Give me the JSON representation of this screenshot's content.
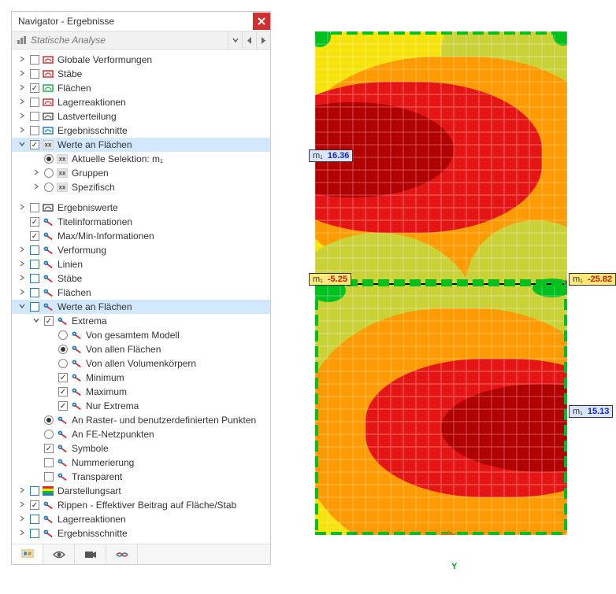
{
  "header": {
    "title": "Navigator - Ergebnisse"
  },
  "dropdown": {
    "label": "Statische Analyse"
  },
  "tree": [
    {
      "lvl": 0,
      "exp": ">",
      "ck": "box",
      "checked": false,
      "iconColor": "#d03030",
      "label": "Globale Verformungen"
    },
    {
      "lvl": 0,
      "exp": ">",
      "ck": "box",
      "checked": false,
      "iconColor": "#d03030",
      "label": "Stäbe"
    },
    {
      "lvl": 0,
      "exp": ">",
      "ck": "box",
      "checked": true,
      "iconColor": "#2aa84a",
      "label": "Flächen"
    },
    {
      "lvl": 0,
      "exp": ">",
      "ck": "box",
      "checked": false,
      "iconColor": "#d03030",
      "label": "Lagerreaktionen"
    },
    {
      "lvl": 0,
      "exp": ">",
      "ck": "box",
      "checked": false,
      "iconColor": "#555",
      "label": "Lastverteilung"
    },
    {
      "lvl": 0,
      "exp": ">",
      "ck": "box",
      "checked": false,
      "iconColor": "#2a7ab8",
      "label": "Ergebnisschnitte"
    },
    {
      "lvl": 0,
      "exp": "v",
      "ck": "box",
      "checked": true,
      "iconColor": "#888",
      "label": "Werte an Flächen",
      "sel": true,
      "xx": true
    },
    {
      "lvl": 1,
      "exp": " ",
      "ck": "radio",
      "checked": true,
      "iconColor": "#888",
      "label": "Aktuelle Selektion: m₁",
      "xx": true
    },
    {
      "lvl": 1,
      "exp": ">",
      "ck": "radio",
      "checked": false,
      "iconColor": "#888",
      "label": "Gruppen",
      "xx": true
    },
    {
      "lvl": 1,
      "exp": ">",
      "ck": "radio",
      "checked": false,
      "iconColor": "#888",
      "label": "Spezifisch",
      "xx": true
    },
    {
      "lvl": 0,
      "exp": ">",
      "ck": "box",
      "checked": false,
      "iconColor": "#555",
      "label": "Ergebniswerte",
      "divider": true
    },
    {
      "lvl": 0,
      "exp": " ",
      "ck": "box",
      "checked": true,
      "iconColor": "#2a7ab8",
      "label": "Titelinformationen",
      "pin": true
    },
    {
      "lvl": 0,
      "exp": " ",
      "ck": "box",
      "checked": true,
      "iconColor": "#2a7ab8",
      "label": "Max/Min-Informationen",
      "pin": true
    },
    {
      "lvl": 0,
      "exp": ">",
      "ck": "boxb",
      "checked": false,
      "iconColor": "#2a7ab8",
      "label": "Verformung",
      "pin": true
    },
    {
      "lvl": 0,
      "exp": ">",
      "ck": "boxb",
      "checked": false,
      "iconColor": "#2a7ab8",
      "label": "Linien",
      "pin": true
    },
    {
      "lvl": 0,
      "exp": ">",
      "ck": "boxb",
      "checked": false,
      "iconColor": "#2a7ab8",
      "label": "Stäbe",
      "pin": true
    },
    {
      "lvl": 0,
      "exp": ">",
      "ck": "boxb",
      "checked": false,
      "iconColor": "#2a7ab8",
      "label": "Flächen",
      "pin": true
    },
    {
      "lvl": 0,
      "exp": "v",
      "ck": "boxb",
      "checked": false,
      "iconColor": "#2a7ab8",
      "label": "Werte an Flächen",
      "sel": true,
      "pin": true
    },
    {
      "lvl": 1,
      "exp": "v",
      "ck": "box",
      "checked": true,
      "iconColor": "#2a7ab8",
      "label": "Extrema",
      "pin": true
    },
    {
      "lvl": 2,
      "exp": " ",
      "ck": "radio",
      "checked": false,
      "iconColor": "#2a7ab8",
      "label": "Von gesamtem Modell",
      "pin": true
    },
    {
      "lvl": 2,
      "exp": " ",
      "ck": "radio",
      "checked": true,
      "iconColor": "#2a7ab8",
      "label": "Von allen Flächen",
      "pin": true
    },
    {
      "lvl": 2,
      "exp": " ",
      "ck": "radio",
      "checked": false,
      "iconColor": "#2a7ab8",
      "label": "Von allen Volumenkörpern",
      "pin": true
    },
    {
      "lvl": 2,
      "exp": " ",
      "ck": "box",
      "checked": true,
      "iconColor": "#2a7ab8",
      "label": "Minimum",
      "pin": true
    },
    {
      "lvl": 2,
      "exp": " ",
      "ck": "box",
      "checked": true,
      "iconColor": "#2a7ab8",
      "label": "Maximum",
      "pin": true
    },
    {
      "lvl": 2,
      "exp": " ",
      "ck": "box",
      "checked": true,
      "iconColor": "#2a7ab8",
      "label": "Nur Extrema",
      "pin": true
    },
    {
      "lvl": 1,
      "exp": " ",
      "ck": "radio",
      "checked": true,
      "iconColor": "#2a7ab8",
      "label": "An Raster- und benutzerdefinierten Punkten",
      "pin": true
    },
    {
      "lvl": 1,
      "exp": " ",
      "ck": "radio",
      "checked": false,
      "iconColor": "#2a7ab8",
      "label": "An FE-Netzpunkten",
      "pin": true
    },
    {
      "lvl": 1,
      "exp": " ",
      "ck": "box",
      "checked": true,
      "iconColor": "#2a7ab8",
      "label": "Symbole",
      "pin": true
    },
    {
      "lvl": 1,
      "exp": " ",
      "ck": "box",
      "checked": false,
      "iconColor": "#2a7ab8",
      "label": "Nummerierung",
      "pin": true
    },
    {
      "lvl": 1,
      "exp": " ",
      "ck": "box",
      "checked": false,
      "iconColor": "#2a7ab8",
      "label": "Transparent",
      "pin": true
    },
    {
      "lvl": 0,
      "exp": ">",
      "ck": "boxb",
      "checked": false,
      "iconColor": "rainbow",
      "label": "Darstellungsart"
    },
    {
      "lvl": 0,
      "exp": ">",
      "ck": "box",
      "checked": true,
      "iconColor": "#2a7ab8",
      "label": "Rippen - Effektiver Beitrag auf Fläche/Stab",
      "pin": true
    },
    {
      "lvl": 0,
      "exp": ">",
      "ck": "boxb",
      "checked": false,
      "iconColor": "#2a7ab8",
      "label": "Lagerreaktionen",
      "pin": true
    },
    {
      "lvl": 0,
      "exp": ">",
      "ck": "boxb",
      "checked": false,
      "iconColor": "#2a7ab8",
      "label": "Ergebnisschnitte",
      "pin": true
    }
  ],
  "values": {
    "m1_top": {
      "m": "m₁",
      "v": "16.36",
      "cls": "pos"
    },
    "m1_midL": {
      "m": "m₁",
      "v": "-5.25",
      "cls": "neg"
    },
    "m1_midR": {
      "m": "m₁",
      "v": "-25.82",
      "cls": "neg"
    },
    "m1_bot": {
      "m": "m₁",
      "v": "15.13",
      "cls": "pos"
    }
  },
  "chart_data": {
    "type": "heatmap",
    "title": "m₁",
    "extrema": [
      {
        "surface": "top",
        "kind": "max",
        "value": 16.36
      },
      {
        "surface": "edge",
        "kind": "min",
        "value": -5.25,
        "pos": "mid-left"
      },
      {
        "surface": "edge",
        "kind": "min",
        "value": -25.82,
        "pos": "mid-right"
      },
      {
        "surface": "bot",
        "kind": "max",
        "value": 15.13
      }
    ],
    "color_scale": [
      "#00c020",
      "#cad238",
      "#f7e40c",
      "#ff9a00",
      "#e31515",
      "#b00000"
    ]
  },
  "axis": {
    "y": "Y"
  }
}
